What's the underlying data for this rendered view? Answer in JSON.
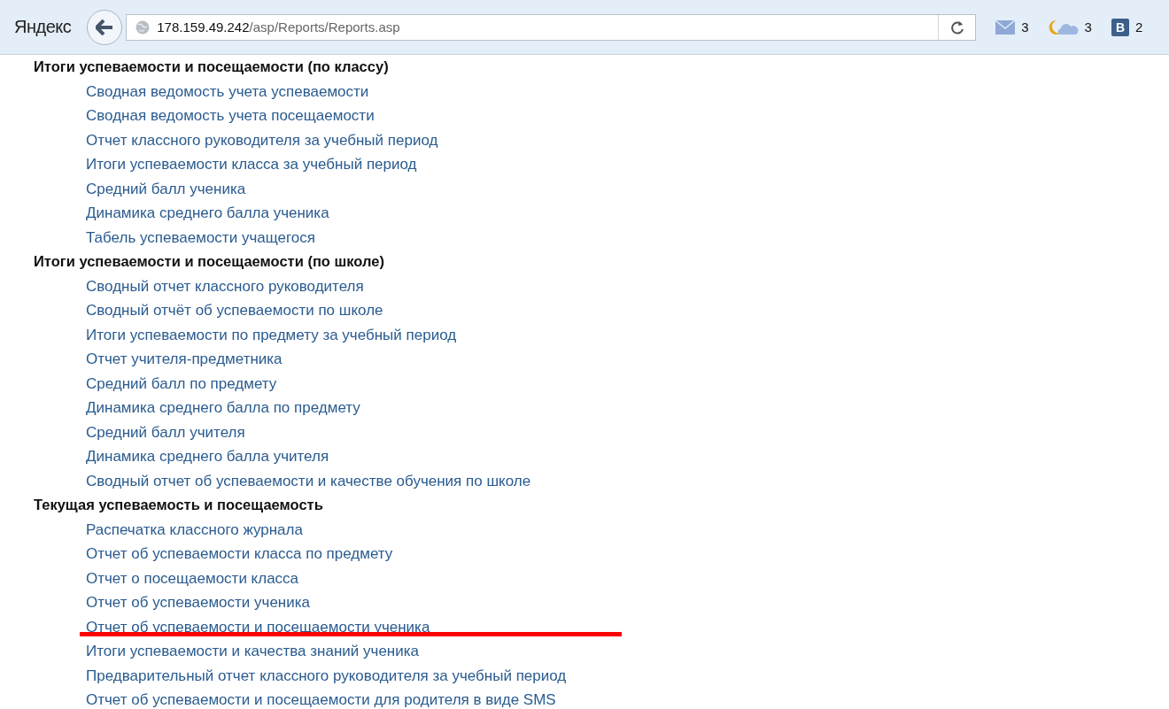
{
  "browser": {
    "logo": "Яндекс",
    "url_host": "178.159.49.242",
    "url_path": "/asp/Reports/Reports.asp",
    "widgets": [
      {
        "kind": "mail",
        "count": "3"
      },
      {
        "kind": "weather",
        "count": "3"
      },
      {
        "kind": "vk",
        "letter": "B",
        "count": "2"
      }
    ]
  },
  "sections": [
    {
      "title": "Итоги успеваемости и посещаемости (по классу)",
      "items": [
        {
          "label": "Сводная ведомость учета успеваемости",
          "highlighted": false
        },
        {
          "label": "Сводная ведомость учета посещаемости",
          "highlighted": false
        },
        {
          "label": "Отчет классного руководителя за учебный период",
          "highlighted": false
        },
        {
          "label": "Итоги успеваемости класса за учебный период",
          "highlighted": false
        },
        {
          "label": "Средний балл ученика",
          "highlighted": false
        },
        {
          "label": "Динамика среднего балла ученика",
          "highlighted": false
        },
        {
          "label": "Табель успеваемости учащегося",
          "highlighted": false
        }
      ]
    },
    {
      "title": "Итоги успеваемости и посещаемости (по школе)",
      "items": [
        {
          "label": "Сводный отчет классного руководителя",
          "highlighted": false
        },
        {
          "label": "Сводный отчёт об успеваемости по школе",
          "highlighted": false
        },
        {
          "label": "Итоги успеваемости по предмету за учебный период",
          "highlighted": false
        },
        {
          "label": "Отчет учителя-предметника",
          "highlighted": false
        },
        {
          "label": "Средний балл по предмету",
          "highlighted": false
        },
        {
          "label": "Динамика среднего балла по предмету",
          "highlighted": false
        },
        {
          "label": "Средний балл учителя",
          "highlighted": false
        },
        {
          "label": "Динамика среднего балла учителя",
          "highlighted": false
        },
        {
          "label": "Сводный отчет об успеваемости и качестве обучения по школе",
          "highlighted": false
        }
      ]
    },
    {
      "title": "Текущая успеваемость и посещаемость",
      "items": [
        {
          "label": "Распечатка классного журнала",
          "highlighted": false
        },
        {
          "label": "Отчет об успеваемости класса по предмету",
          "highlighted": false
        },
        {
          "label": "Отчет о посещаемости класса",
          "highlighted": false
        },
        {
          "label": "Отчет об успеваемости ученика",
          "highlighted": false
        },
        {
          "label": "Отчет об успеваемости и посещаемости ученика",
          "highlighted": true
        },
        {
          "label": "Итоги успеваемости и качества знаний ученика",
          "highlighted": false
        },
        {
          "label": "Предварительный отчет классного руководителя за учебный период",
          "highlighted": false
        },
        {
          "label": "Отчет об успеваемости и посещаемости для родителя в виде SMS",
          "highlighted": false
        }
      ]
    }
  ]
}
